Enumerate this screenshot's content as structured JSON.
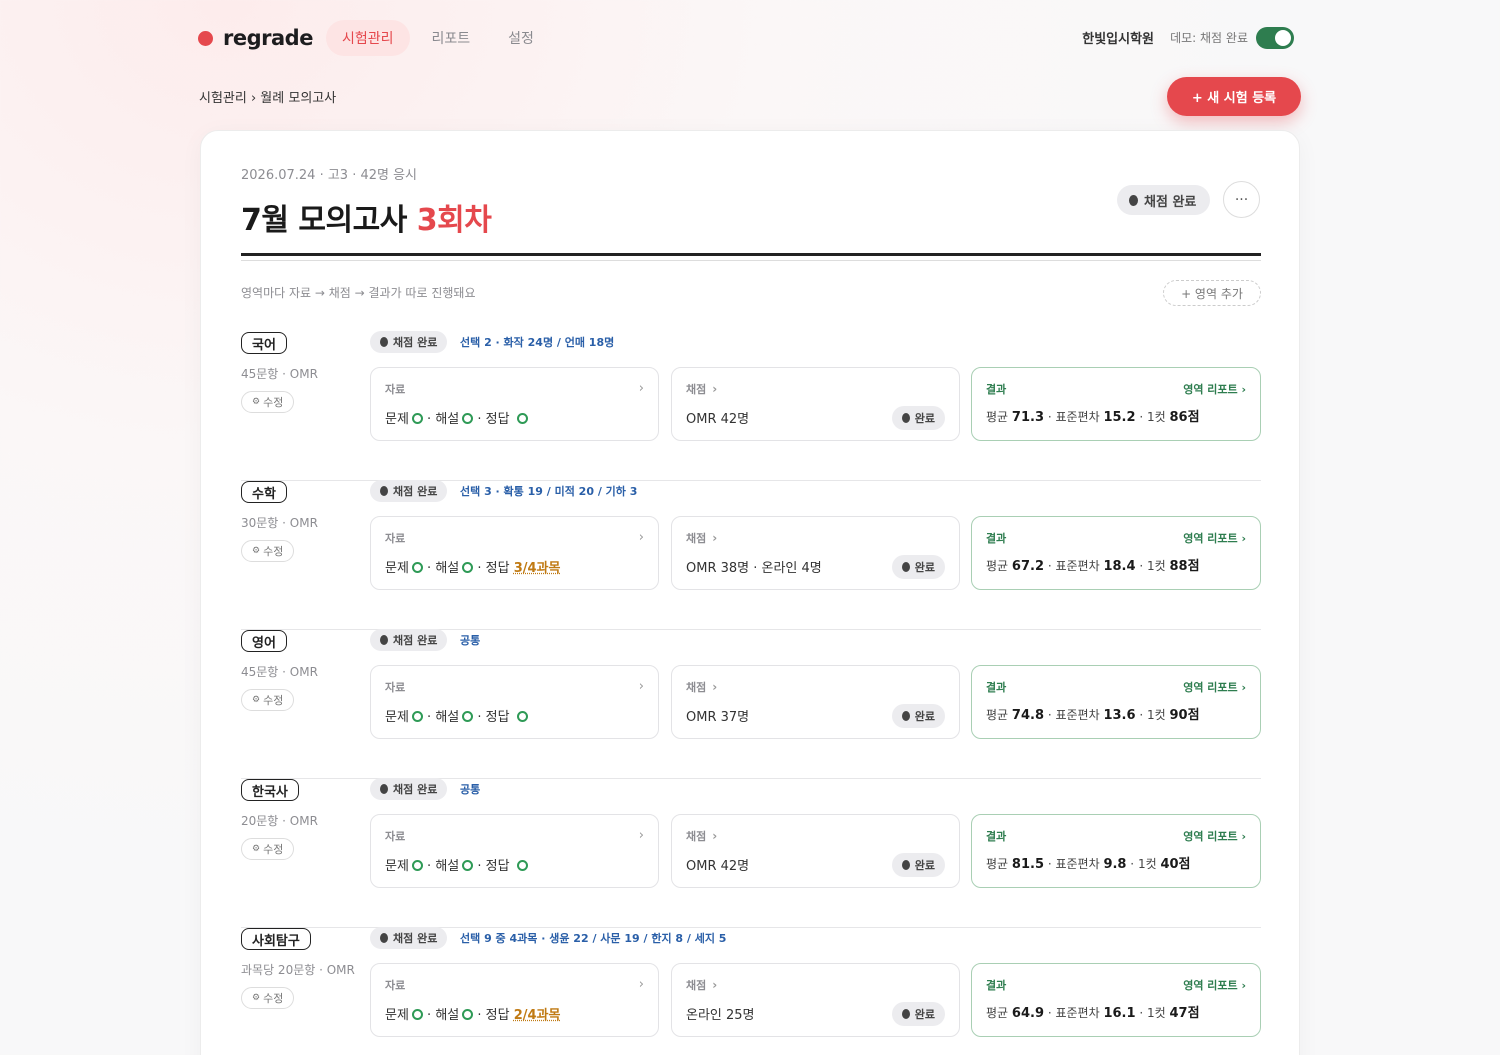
{
  "app": {
    "logo": "regrade",
    "org": "한빛입시학원",
    "demo_label": "데모: 채점 완료"
  },
  "nav": {
    "items": [
      "시험관리",
      "리포트",
      "설정"
    ],
    "active": 0
  },
  "breadcrumb": "시험관리 › 월례 모의고사",
  "actions": {
    "new_exam": "+ 새 시험 등록",
    "add_area": "+ 영역 추가",
    "more": "···"
  },
  "exam": {
    "meta": "2026.07.24 · 고3 · 42명 응시",
    "title_main": "7월 모의고사 ",
    "title_accent": "3회차",
    "status": "채점 완료",
    "hint": "영역마다 자료 → 채점 → 결과가 따로 진행돼요"
  },
  "labels": {
    "data": "자료",
    "grade": "채점",
    "result": "결과",
    "area_report": "영역 리포트 ›",
    "edit": "수정",
    "done": "완료",
    "problem": "문제",
    "solution": "해설",
    "answer": "정답",
    "avg": "평균",
    "sd": "표준편차",
    "cut": "1컷"
  },
  "sections": [
    {
      "subject": "국어",
      "meta": "45문항 · OMR",
      "status": "채점 완료",
      "choice": "선택 2 · 화작 24명 / 언매 18명",
      "answer_partial": "",
      "grading": "OMR 42명",
      "avg": "71.3",
      "sd": "15.2",
      "cut": "86점"
    },
    {
      "subject": "수학",
      "meta": "30문항 · OMR",
      "status": "채점 완료",
      "choice": "선택 3 · 확통 19 / 미적 20 / 기하 3",
      "answer_partial": "3/4과목",
      "grading": "OMR 38명 · 온라인 4명",
      "avg": "67.2",
      "sd": "18.4",
      "cut": "88점"
    },
    {
      "subject": "영어",
      "meta": "45문항 · OMR",
      "status": "채점 완료",
      "choice": "공통",
      "answer_partial": "",
      "grading": "OMR 37명",
      "avg": "74.8",
      "sd": "13.6",
      "cut": "90점"
    },
    {
      "subject": "한국사",
      "meta": "20문항 · OMR",
      "status": "채점 완료",
      "choice": "공통",
      "answer_partial": "",
      "grading": "OMR 42명",
      "avg": "81.5",
      "sd": "9.8",
      "cut": "40점"
    },
    {
      "subject": "사회탐구",
      "meta": "과목당 20문항 · OMR",
      "status": "채점 완료",
      "choice": "선택 9 중 4과목 · 생윤 22 / 사문 19 / 한지 8 / 세지 5",
      "answer_partial": "2/4과목",
      "grading": "온라인 25명",
      "avg": "64.9",
      "sd": "16.1",
      "cut": "47점"
    }
  ],
  "colors": {
    "accent": "#e5484d",
    "success": "#2e7d4f",
    "ok_circle": "#2e9a56",
    "partial": "#c07a13",
    "choice_text": "#2a5fa8"
  }
}
